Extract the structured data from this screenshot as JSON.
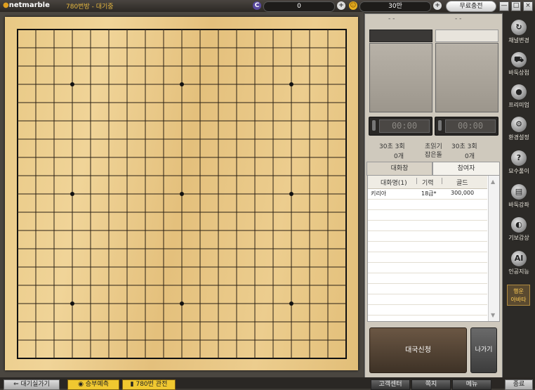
{
  "titlebar": {
    "logo": "netmarble",
    "room_title": "780번방 - 대기중",
    "c_icon": "C",
    "c_value": "0",
    "gold_value": "30만",
    "charge_label": "무료충전",
    "win_min": "—",
    "win_max": "□",
    "win_close": "×"
  },
  "board": {
    "size": 19,
    "star_points": [
      [
        3,
        3
      ],
      [
        3,
        9
      ],
      [
        3,
        15
      ],
      [
        9,
        3
      ],
      [
        9,
        9
      ],
      [
        9,
        15
      ],
      [
        15,
        3
      ],
      [
        15,
        9
      ],
      [
        15,
        15
      ]
    ]
  },
  "panel": {
    "top_left_label": "-          -",
    "top_right_label": "-          -",
    "timer_left": "00:00",
    "timer_right": "00:00",
    "left_time": "30초  3회",
    "left_count": "0개",
    "mid_label1": "초읽기",
    "mid_label2": "잡은돌",
    "right_time": "30초  3회",
    "right_count": "0개"
  },
  "tabs": {
    "chat": "대화창",
    "participants": "참여자"
  },
  "list": {
    "headers": {
      "name": "대화명(1)",
      "rank": "기력",
      "gold": "골드"
    },
    "rows": [
      {
        "name": "키리아",
        "rank": "18급*",
        "gold": "300,000"
      }
    ]
  },
  "buttons": {
    "apply": "대국신청",
    "leave": "나가기"
  },
  "sidemenu": {
    "items": [
      {
        "label": "채널변경",
        "icon": "refresh-icon"
      },
      {
        "label": "바둑상점",
        "icon": "cart-icon"
      },
      {
        "label": "프리미엄",
        "icon": "premium-icon"
      },
      {
        "label": "환경설정",
        "icon": "gear-icon"
      },
      {
        "label": "묘수풀이",
        "icon": "question-icon"
      },
      {
        "label": "바둑강좌",
        "icon": "book-icon"
      },
      {
        "label": "기보감상",
        "icon": "stones-icon"
      },
      {
        "label": "인공지능",
        "icon": "ai-icon"
      }
    ],
    "avatar_line1": "행운",
    "avatar_line2": "아바타"
  },
  "bottom": {
    "waiting_room": "대기실가기",
    "prediction": "승부예측",
    "watch": "780번 관전",
    "support": "고객센터",
    "note": "쪽지",
    "menu": "메뉴",
    "exit": "종료"
  },
  "colors": {
    "accent": "#e6b840",
    "board": "#ecce90"
  }
}
